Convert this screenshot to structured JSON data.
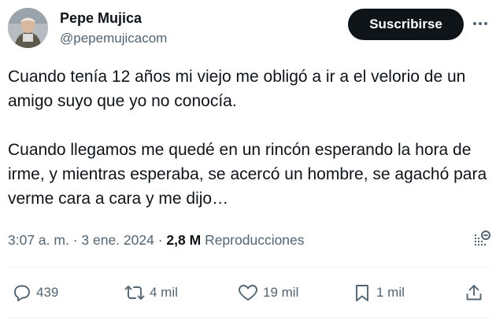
{
  "author": {
    "display_name": "Pepe Mujica",
    "handle": "@pepemujicacom",
    "avatar_icon": "profile-photo"
  },
  "header": {
    "subscribe_label": "Suscribirse",
    "more_icon": "more-dots-icon"
  },
  "tweet": {
    "paragraphs": [
      "Cuando tenía 12 años mi viejo me obligó a ir a el velorio de un amigo suyo que yo no conocía.",
      "Cuando llegamos me quedé en un rincón esperando la hora de irme, y mientras esperaba, se acercó un hombre, se agachó para verme cara a cara y me dijo…"
    ]
  },
  "meta": {
    "time": "3:07 a. m.",
    "separator": " · ",
    "date": "3 ene. 2024",
    "separator2": " · ",
    "views_count": "2,8 M",
    "views_label": "Reproducciones",
    "analytics_icon": "analytics-icon"
  },
  "actions": {
    "reply_count": "439",
    "retweet_count": "4 mil",
    "like_count": "19 mil",
    "bookmark_count": "1 mil"
  },
  "colors": {
    "text": "#0f1419",
    "secondary": "#536471",
    "button_bg": "#0f1419",
    "divider": "#eff3f4"
  }
}
